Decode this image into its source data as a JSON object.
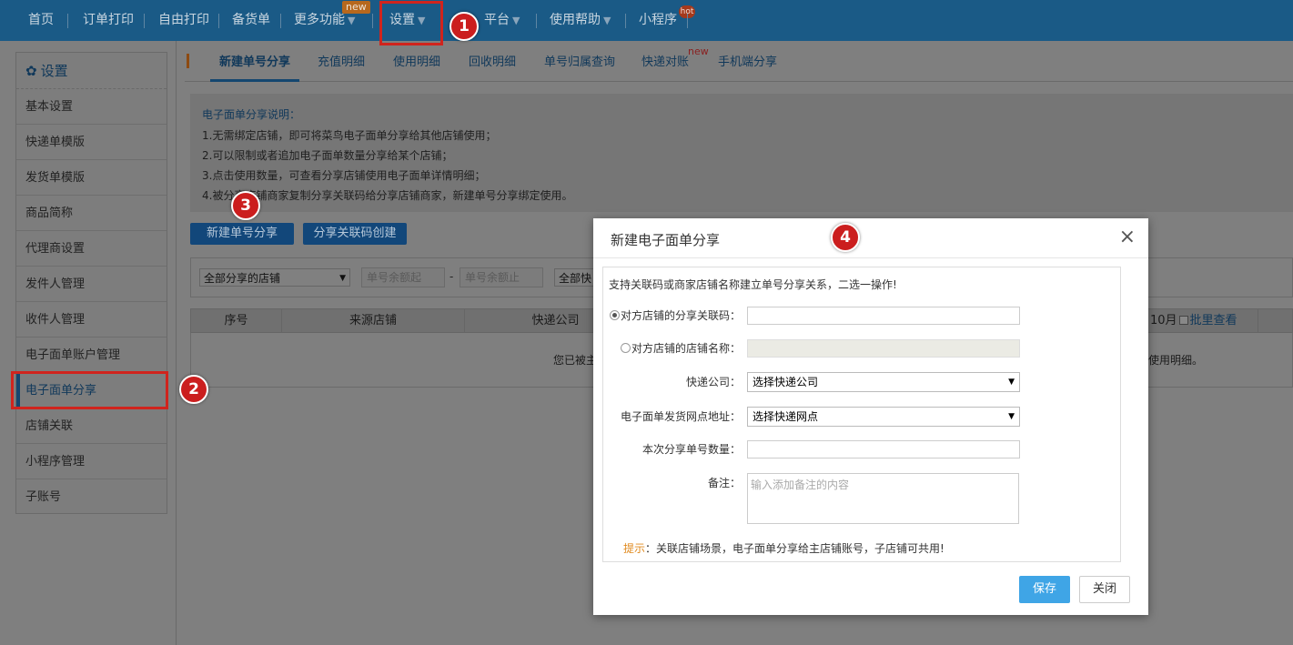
{
  "nav": {
    "items": [
      "首页",
      "订单打印",
      "自由打印",
      "备货单",
      "更多功能",
      "设置",
      "平台",
      "使用帮助",
      "小程序"
    ],
    "new_badge": "new",
    "hot_badge": "hot"
  },
  "annotations": [
    "1",
    "2",
    "3",
    "4"
  ],
  "sidebar": {
    "title": "设置",
    "items": [
      "基本设置",
      "快递单模版",
      "发货单模版",
      "商品简称",
      "代理商设置",
      "发件人管理",
      "收件人管理",
      "电子面单账户管理",
      "电子面单分享",
      "店铺关联",
      "小程序管理",
      "子账号"
    ]
  },
  "tabs": {
    "items": [
      "新建单号分享",
      "充值明细",
      "使用明细",
      "回收明细",
      "单号归属查询",
      "快递对账",
      "手机端分享"
    ],
    "new_badge": "new"
  },
  "info": {
    "title": "电子面单分享说明：",
    "lines": [
      "1.无需绑定店铺，即可将菜鸟电子面单分享给其他店铺使用；",
      "2.可以限制或者追加电子面单数量分享给某个店铺；",
      "3.点击使用数量，可查看分享店铺使用电子面单详情明细；",
      "4.被分享店铺商家复制分享关联码给分享店铺商家，新建单号分享绑定使用。"
    ]
  },
  "actions": {
    "new_share": "新建单号分享",
    "create_code": "分享关联码创建"
  },
  "filters": {
    "shop_select": "全部分享的店铺",
    "balance_from_placeholder": "单号余额起",
    "dash": "-",
    "balance_to_placeholder": "单号余额止",
    "courier_select": "全部快"
  },
  "table": {
    "headers": [
      "序号",
      "来源店铺",
      "快递公司"
    ],
    "right_month": "10月",
    "batch_view": "批里查看",
    "empty_left": "您已被主",
    "empty_right": "使用明细。"
  },
  "modal": {
    "title": "新建电子面单分享",
    "close_glyph": "×",
    "description": "支持关联码或商家店铺名称建立单号分享关系，二选一操作!",
    "fields": {
      "code_label": "对方店铺的分享关联码：",
      "name_label": "对方店铺的店铺名称：",
      "courier_label": "快递公司：",
      "courier_value": "选择快递公司",
      "site_label": "电子面单发货网点地址：",
      "site_value": "选择快递网点",
      "qty_label": "本次分享单号数量：",
      "remark_label": "备注：",
      "remark_placeholder": "输入添加备注的内容"
    },
    "tip_key": "提示",
    "tip_text": "：关联店铺场景，电子面单分享给主店铺账号，子店铺可共用!",
    "save": "保存",
    "close": "关闭"
  },
  "colors": {
    "nav_bg": "#1a5a86",
    "primary_button": "#3fa5e6",
    "annotation_red": "#cb1e1e",
    "tip_orange": "#e08a1e"
  }
}
